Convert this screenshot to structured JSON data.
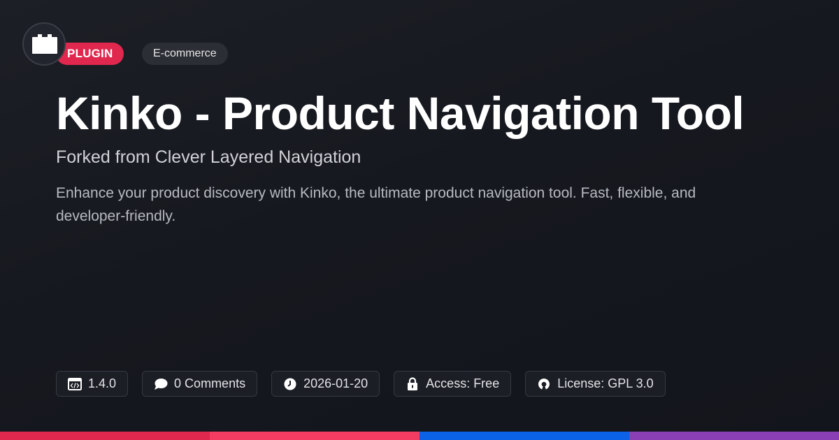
{
  "badges": {
    "type": "PLUGIN",
    "category": "E-commerce"
  },
  "header": {
    "title": "Kinko - Product Navigation Tool",
    "subtitle": "Forked from Clever Layered Navigation",
    "description": "Enhance your product discovery with Kinko, the ultimate product navigation tool. Fast, flexible, and developer-friendly."
  },
  "meta": {
    "version": "1.4.0",
    "comments": "0 Comments",
    "date": "2026-01-20",
    "access": "Access: Free",
    "license": "License: GPL 3.0"
  },
  "icons": {
    "logo": "plugin-block-icon",
    "version": "code-window-icon",
    "comments": "speech-bubble-icon",
    "date": "clock-icon",
    "access": "padlock-icon",
    "license": "open-source-icon"
  },
  "colors": {
    "accent": "#e0284f",
    "bar_segments": [
      "#e0284f",
      "#f43b62",
      "#0b62e6",
      "#8a3fb5"
    ]
  }
}
